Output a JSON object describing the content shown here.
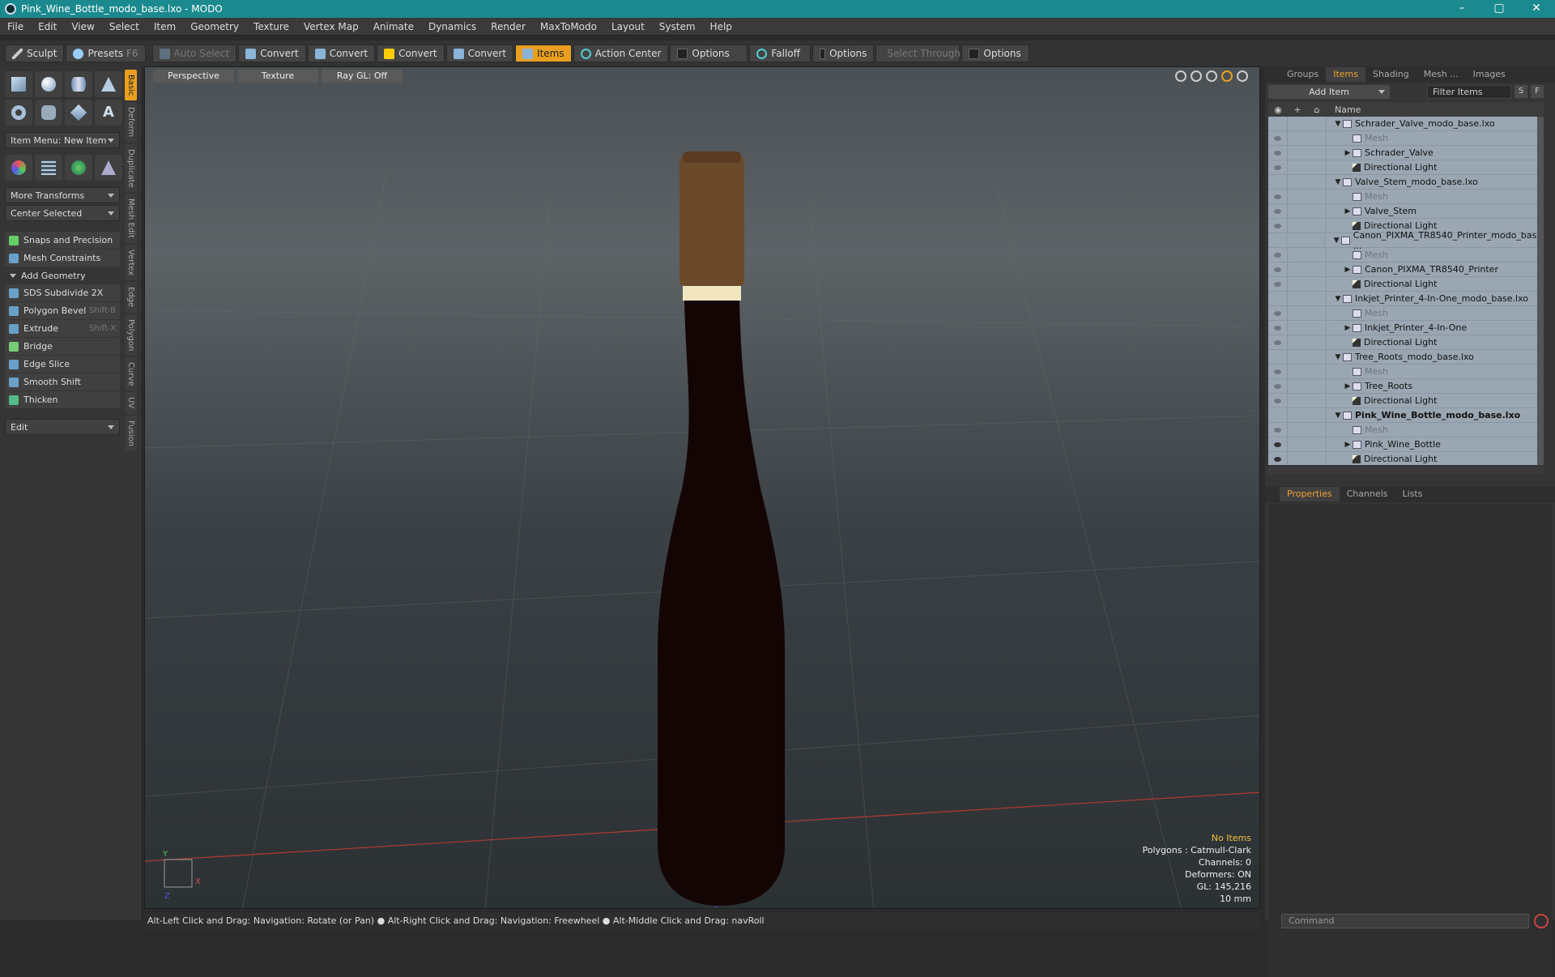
{
  "window": {
    "title": "Pink_Wine_Bottle_modo_base.lxo - MODO",
    "controls": [
      "–",
      "▢",
      "✕"
    ]
  },
  "menu": [
    "File",
    "Edit",
    "View",
    "Select",
    "Item",
    "Geometry",
    "Texture",
    "Vertex Map",
    "Animate",
    "Dynamics",
    "Render",
    "MaxToModo",
    "Layout",
    "System",
    "Help"
  ],
  "toolbar": {
    "sculpt": "Sculpt",
    "presets": "Presets",
    "presets_key": "F6",
    "auto_select": "Auto Select",
    "convert1": "Convert",
    "convert2": "Convert",
    "convert3": "Convert",
    "convert4": "Convert",
    "items": "Items",
    "action_center": "Action Center",
    "options1": "Options",
    "falloff": "Falloff",
    "options2": "Options",
    "select_through": "Select Through",
    "options3": "Options"
  },
  "left_panel": {
    "item_menu": "Item Menu: New Item",
    "more_transforms": "More Transforms",
    "center_selected": "Center Selected",
    "snaps": "Snaps and Precision",
    "mesh_constraints": "Mesh Constraints",
    "add_geometry": "Add Geometry",
    "tools": [
      {
        "label": "SDS Subdivide 2X",
        "shortcut": ""
      },
      {
        "label": "Polygon Bevel",
        "shortcut": "Shift-B"
      },
      {
        "label": "Extrude",
        "shortcut": "Shift-X"
      },
      {
        "label": "Bridge",
        "shortcut": ""
      },
      {
        "label": "Edge Slice",
        "shortcut": ""
      },
      {
        "label": "Smooth Shift",
        "shortcut": ""
      },
      {
        "label": "Thicken",
        "shortcut": ""
      }
    ],
    "edit_dropdown": "Edit",
    "vertical_tabs": [
      "Basic",
      "Deform",
      "Duplicate",
      "Mesh Edit",
      "Vertex",
      "Edge",
      "Polygon",
      "Curve",
      "UV",
      "Fusion"
    ]
  },
  "viewport": {
    "tabs": [
      "Perspective",
      "Texture",
      "Ray GL: Off"
    ],
    "stats": {
      "selection": "No Items",
      "polygons": "Polygons : Catmull-Clark",
      "channels": "Channels: 0",
      "deformers": "Deformers: ON",
      "gl": "GL: 145,216",
      "scale": "10 mm"
    },
    "axis_x": "X",
    "axis_y": "Y",
    "axis_z": "Z"
  },
  "right_panel": {
    "tabs": [
      "Groups",
      "Items",
      "Shading",
      "Mesh ...",
      "Images"
    ],
    "add_item": "Add Item",
    "filter_placeholder": "Filter Items",
    "s_btn": "S",
    "f_btn": "F",
    "name_header": "Name",
    "tree": [
      {
        "label": "Schrader_Valve_modo_base.lxo",
        "kind": "scene"
      },
      {
        "label": "Mesh",
        "kind": "mesh"
      },
      {
        "label": "Schrader_Valve",
        "kind": "item"
      },
      {
        "label": "Directional Light",
        "kind": "light"
      },
      {
        "label": "Valve_Stem_modo_base.lxo",
        "kind": "scene"
      },
      {
        "label": "Mesh",
        "kind": "mesh"
      },
      {
        "label": "Valve_Stem",
        "kind": "item"
      },
      {
        "label": "Directional Light",
        "kind": "light"
      },
      {
        "label": "Canon_PIXMA_TR8540_Printer_modo_bas ...",
        "kind": "scene"
      },
      {
        "label": "Mesh",
        "kind": "mesh"
      },
      {
        "label": "Canon_PIXMA_TR8540_Printer",
        "kind": "item"
      },
      {
        "label": "Directional Light",
        "kind": "light"
      },
      {
        "label": "Inkjet_Printer_4-In-One_modo_base.lxo",
        "kind": "scene"
      },
      {
        "label": "Mesh",
        "kind": "mesh"
      },
      {
        "label": "Inkjet_Printer_4-In-One",
        "kind": "item"
      },
      {
        "label": "Directional Light",
        "kind": "light"
      },
      {
        "label": "Tree_Roots_modo_base.lxo",
        "kind": "scene"
      },
      {
        "label": "Mesh",
        "kind": "mesh"
      },
      {
        "label": "Tree_Roots",
        "kind": "item"
      },
      {
        "label": "Directional Light",
        "kind": "light"
      },
      {
        "label": "Pink_Wine_Bottle_modo_base.lxo",
        "kind": "scene-bold"
      },
      {
        "label": "Mesh",
        "kind": "mesh"
      },
      {
        "label": "Pink_Wine_Bottle",
        "kind": "item"
      },
      {
        "label": "Directional Light",
        "kind": "light"
      }
    ],
    "props_tabs": [
      "Properties",
      "Channels",
      "Lists"
    ],
    "command_placeholder": "Command"
  },
  "status": "Alt-Left Click and Drag: Navigation: Rotate (or Pan) ● Alt-Right Click and Drag: Navigation: Freewheel ● Alt-Middle Click and Drag: navRoll"
}
